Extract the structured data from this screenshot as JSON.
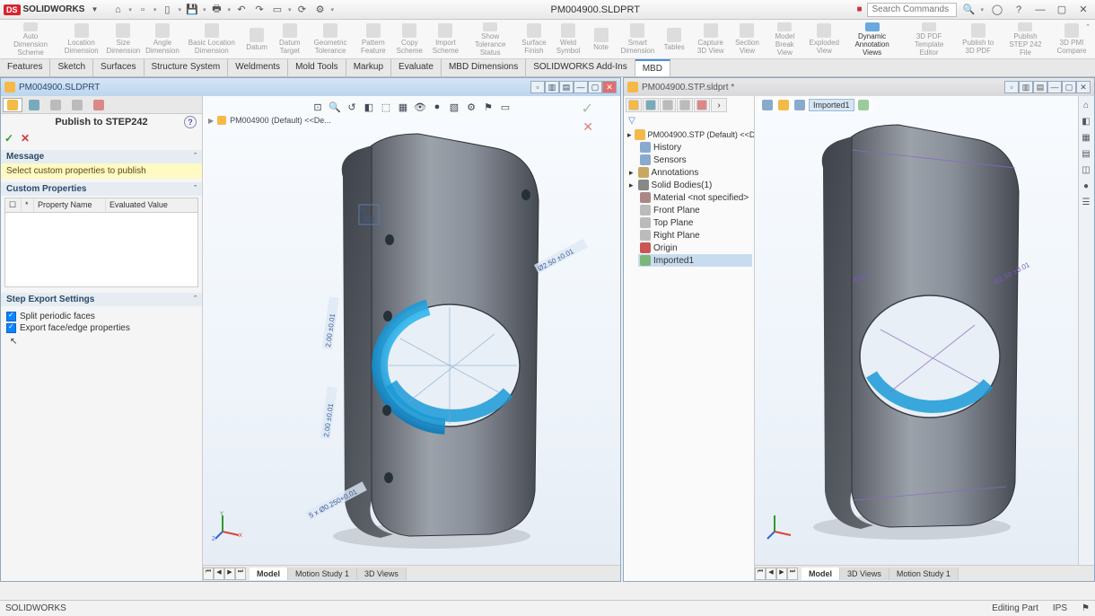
{
  "app": {
    "name": "SOLIDWORKS",
    "doc_title": "PM004900.SLDPRT"
  },
  "qat_search_placeholder": "Search Commands",
  "ribbon": [
    {
      "label": "Auto Dimension Scheme"
    },
    {
      "label": "Location Dimension"
    },
    {
      "label": "Size Dimension"
    },
    {
      "label": "Angle Dimension"
    },
    {
      "label": "Basic Location Dimension"
    },
    {
      "label": "Datum"
    },
    {
      "label": "Datum Target"
    },
    {
      "label": "Geometric Tolerance"
    },
    {
      "label": "Pattern Feature"
    },
    {
      "label": "Copy Scheme"
    },
    {
      "label": "Import Scheme"
    },
    {
      "label": "Show Tolerance Status"
    },
    {
      "label": "Surface Finish"
    },
    {
      "label": "Weld Symbol"
    },
    {
      "label": "Note"
    },
    {
      "label": "Smart Dimension"
    },
    {
      "label": "Tables"
    },
    {
      "label": "Capture 3D View"
    },
    {
      "label": "Section View"
    },
    {
      "label": "Model Break View"
    },
    {
      "label": "Exploded View"
    },
    {
      "label": "Dynamic Annotation Views",
      "active": true
    },
    {
      "label": "3D PDF Template Editor"
    },
    {
      "label": "Publish to 3D PDF"
    },
    {
      "label": "Publish STEP 242 File"
    },
    {
      "label": "3D PMI Compare"
    }
  ],
  "tabs": [
    "Features",
    "Sketch",
    "Surfaces",
    "Structure System",
    "Weldments",
    "Mold Tools",
    "Markup",
    "Evaluate",
    "MBD Dimensions",
    "SOLIDWORKS Add-Ins",
    "MBD"
  ],
  "active_tab": "MBD",
  "left_doc": {
    "title": "PM004900.SLDPRT",
    "pmgr_title": "Publish to STEP242",
    "message_head": "Message",
    "message_body": "Select custom properties to publish",
    "custom_props_head": "Custom Properties",
    "props_cols": {
      "c1": "",
      "c2": "*",
      "c3": "Property Name",
      "c4": "Evaluated Value"
    },
    "export_head": "Step Export Settings",
    "export_opts": [
      "Split periodic faces",
      "Export face/edge properties"
    ],
    "breadcrumb": "PM004900 (Default)  <<De...",
    "bottom_tabs": [
      "Model",
      "Motion Study 1",
      "3D Views"
    ]
  },
  "right_doc": {
    "title": "PM004900.STP.sldprt *",
    "tree_root": "PM004900.STP (Default) <<Default>_D",
    "tree": [
      "History",
      "Sensors",
      "Annotations",
      "Solid Bodies(1)",
      "Material <not specified>",
      "Front Plane",
      "Top Plane",
      "Right Plane",
      "Origin",
      "Imported1"
    ],
    "mini_label": "Imported1",
    "bottom_tabs": [
      "Model",
      "3D Views",
      "Motion Study 1"
    ]
  },
  "status": {
    "left": "SOLIDWORKS",
    "right": "Editing Part",
    "ips": "IPS"
  },
  "dims": {
    "d1": "Ø2.50 ±0.01",
    "d2": "2.00 ±0.01",
    "d3": "2.00 ±0.01",
    "d4": "5 x Ø0.250+0.01"
  }
}
